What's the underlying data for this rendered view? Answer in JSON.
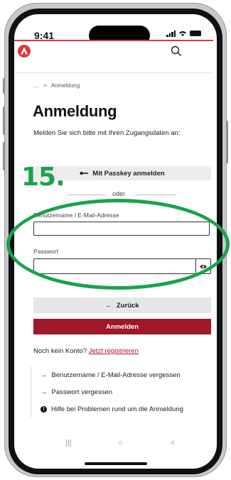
{
  "status": {
    "time": "9:41"
  },
  "breadcrumb": {
    "ellipsis": "…",
    "separator": ">",
    "current": "Anmeldung"
  },
  "page": {
    "title": "Anmeldung",
    "intro": "Melden Sie sich bitte mit Ihren Zugangsdaten an:"
  },
  "passkey": {
    "label": "Mit Passkey anmelden",
    "icon": "key-icon"
  },
  "annotation": {
    "step_number": "15.",
    "color": "#18a34b"
  },
  "divider": {
    "label": "oder"
  },
  "form": {
    "username_label": "Benutzername / E-Mail-Adresse",
    "username_value": "",
    "password_label": "Passwort",
    "password_value": "",
    "show_password_icon": "eye-icon"
  },
  "actions": {
    "back_label": "Zurück",
    "back_icon": "arrow-left-icon",
    "login_label": "Anmelden",
    "login_color": "#a0172a"
  },
  "register": {
    "prompt": "Noch kein Konto?",
    "link_label": "Jetzt registrieren"
  },
  "help_links": [
    {
      "label": "Benutzername / E-Mail-Adresse vergessen",
      "icon": "arrow-right-icon"
    },
    {
      "label": "Passwort vergessen",
      "icon": "arrow-right-icon"
    },
    {
      "label": "Hilfe bei Problemen rund um die Anmeldung",
      "icon": "info-icon"
    }
  ],
  "brand": {
    "accent": "#d93b3b"
  },
  "navbar": {
    "recent": "|||",
    "home": "○",
    "back": "<"
  }
}
